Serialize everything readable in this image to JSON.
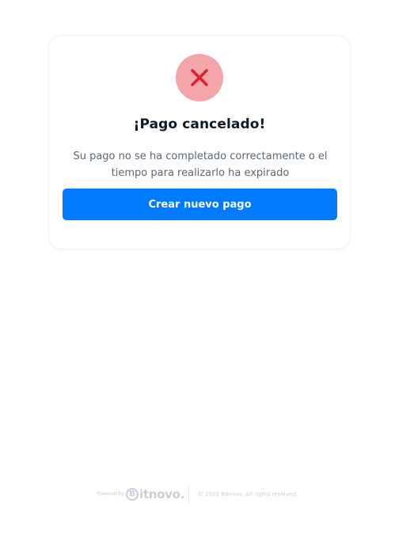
{
  "status": {
    "icon": "close-icon",
    "icon_color": "#e0202e",
    "circle_color": "#f4a5a8"
  },
  "card": {
    "title": "¡Pago cancelado!",
    "message": "Su pago no se ha completado correctamente o el tiempo para realizarlo ha expirado",
    "button_label": "Crear nuevo pago",
    "button_color": "#007aff"
  },
  "footer": {
    "powered_by": "Powered by",
    "brand_mark": "B",
    "brand_name": "itnovo.",
    "copyright": "© 2022 Bitnovo. All rights reserved."
  }
}
